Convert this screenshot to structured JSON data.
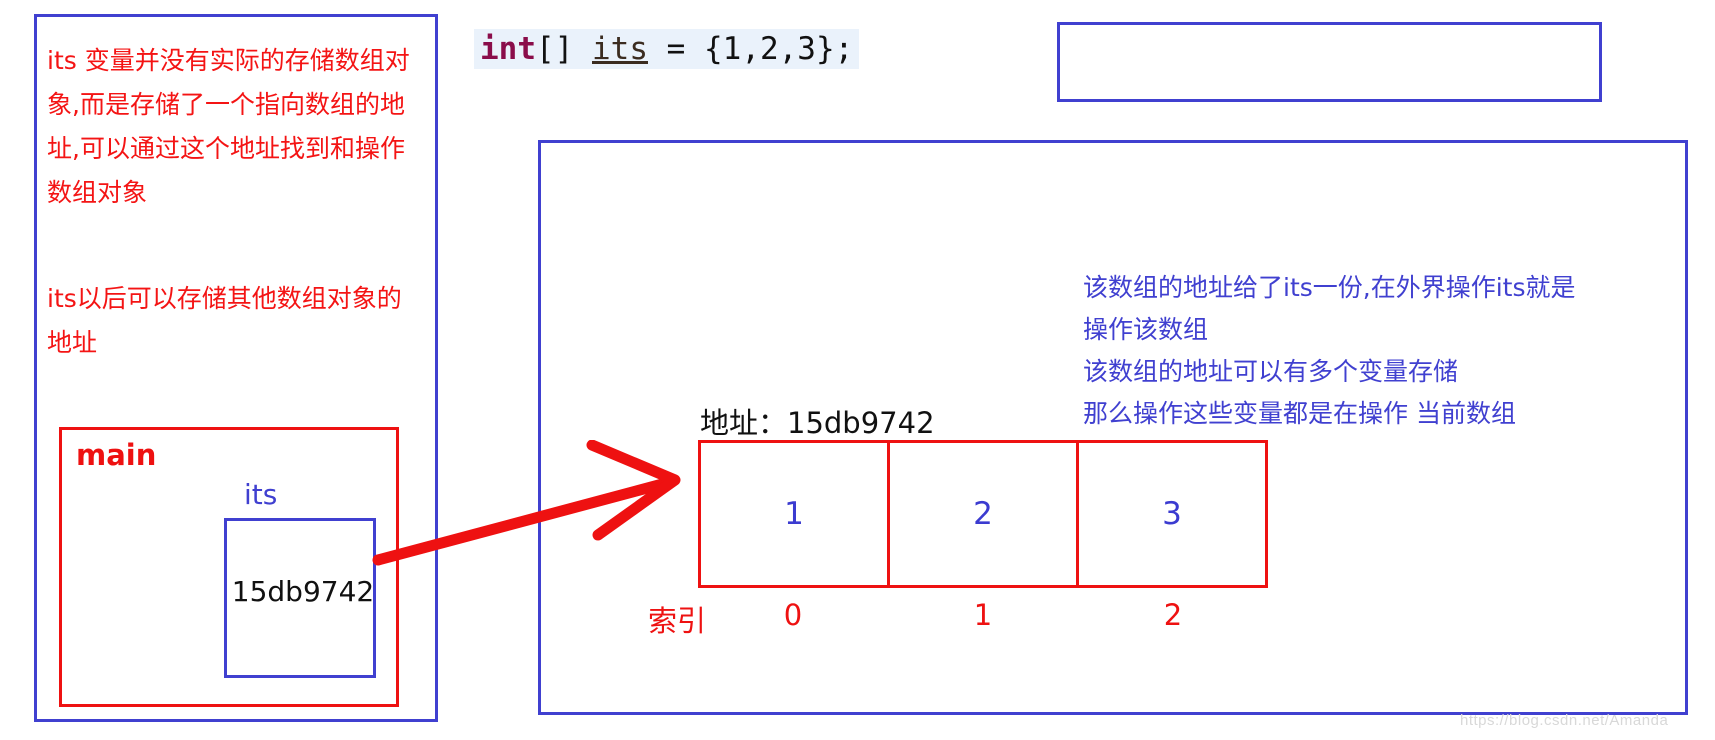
{
  "colors": {
    "red": "#ee1111",
    "bright_red": "#f41414",
    "blue": "#4040d0",
    "value_blue": "#3b3bd0",
    "code_bg": "#eaf2fb",
    "keyword": "#8a0d4a",
    "black": "#111111",
    "watermark": "#d8d8d8"
  },
  "code": {
    "keyword": "int",
    "brackets": "[] ",
    "variable": "its",
    "assignment": " = {1,2,3};",
    "full_text": "int[] its = {1,2,3};"
  },
  "left_panel": {
    "note_1": "its 变量并没有实际的存储数组对象,而是存储了一个指向数组的地址,可以通过这个地址找到和操作数组对象",
    "note_2": "its以后可以存储其他数组对象的地址",
    "stack_frame": {
      "name": "main",
      "variable_label": "its",
      "variable_value": "15db9742"
    }
  },
  "heap_panel": {
    "address_caption": "地址：15db9742",
    "array_values": [
      "1",
      "2",
      "3"
    ],
    "index_label": "索引",
    "index_values": [
      "0",
      "1",
      "2"
    ],
    "annotations": "该数组的地址给了its一份,在外界操作its就是\n操作该数组\n该数组的地址可以有多个变量存储\n那么操作这些变量都是在操作 当前数组"
  },
  "watermark": "https://blog.csdn.net/Amanda"
}
